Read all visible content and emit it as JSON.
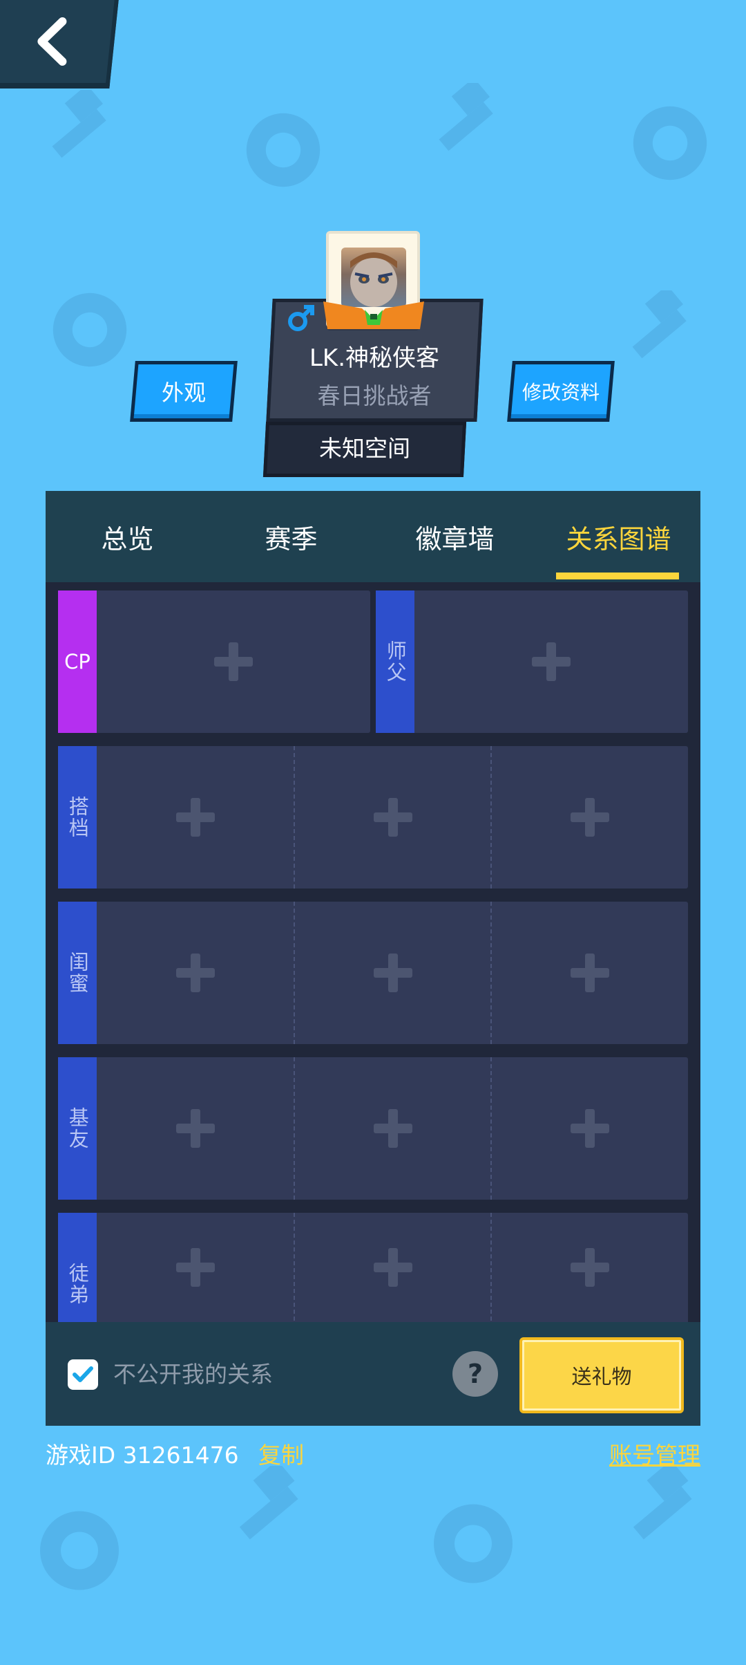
{
  "profile": {
    "name": "LK.神秘侠客",
    "title": "春日挑战者",
    "location": "未知空间",
    "gender_icon": "male-icon"
  },
  "buttons": {
    "appearance": "外观",
    "edit_profile": "修改资料",
    "send_gift": "送礼物",
    "help": "?"
  },
  "tabs": [
    {
      "label": "总览",
      "active": false
    },
    {
      "label": "赛季",
      "active": false
    },
    {
      "label": "徽章墙",
      "active": false
    },
    {
      "label": "关系图谱",
      "active": true
    }
  ],
  "relations": {
    "cp": "CP",
    "master": "师父",
    "rows": [
      {
        "label": "搭档"
      },
      {
        "label": "闺蜜"
      },
      {
        "label": "基友"
      },
      {
        "label": "徒弟"
      }
    ]
  },
  "footer": {
    "privacy_label": "不公开我的关系",
    "privacy_checked": true
  },
  "bottom": {
    "game_id": "游戏ID 31261476",
    "copy": "复制",
    "account": "账号管理"
  },
  "colors": {
    "background": "#5cc4fb",
    "accent_yellow": "#fcd53c",
    "cp_purple": "#b52ff0",
    "relation_blue": "#2d4fcc",
    "button_blue": "#1da4ff"
  }
}
